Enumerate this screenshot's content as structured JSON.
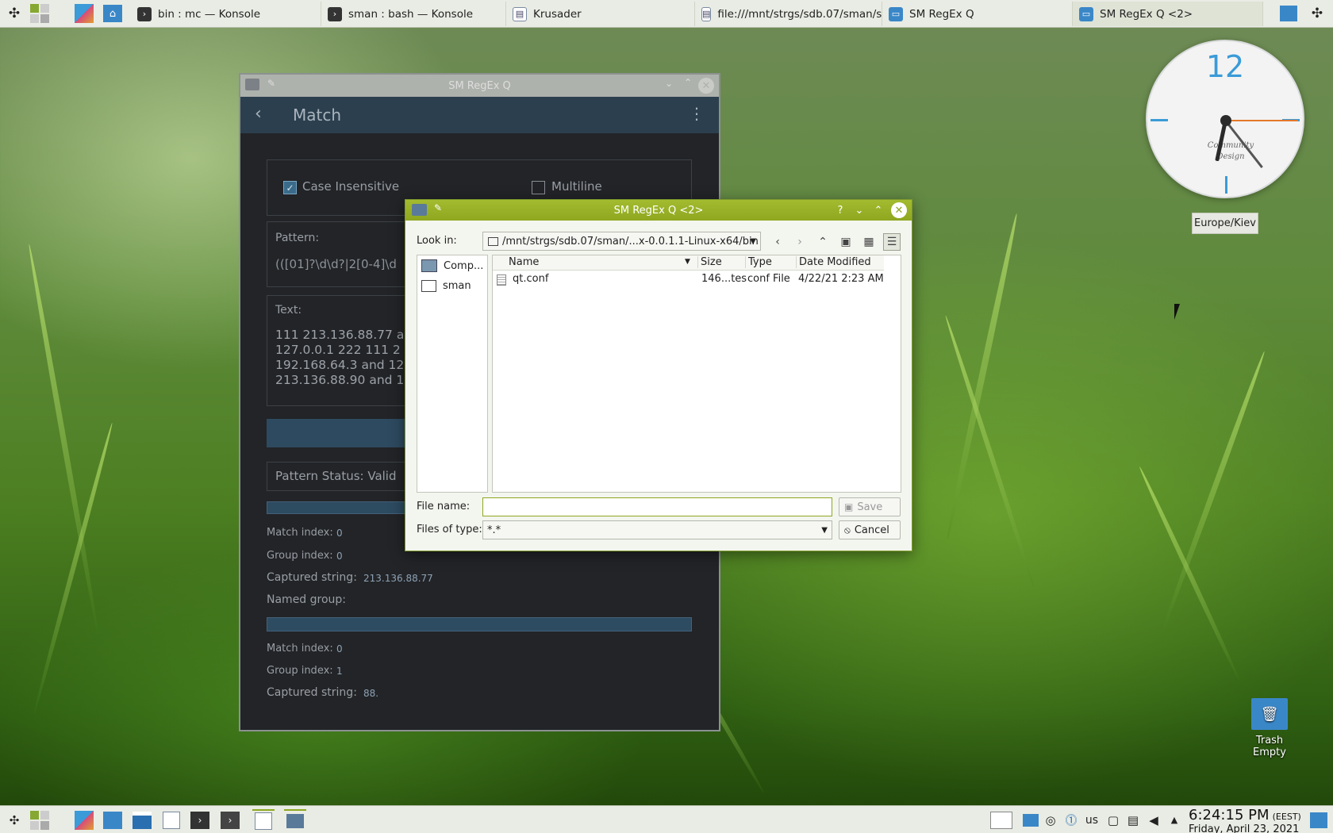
{
  "taskbar": {
    "tasks": [
      {
        "label": "bin : mc — Konsole",
        "icon": "terminal-icon"
      },
      {
        "label": "sman : bash — Konsole",
        "icon": "terminal-icon"
      },
      {
        "label": "Krusader",
        "icon": "krusader-icon"
      },
      {
        "label": "file:///mnt/strgs/sdb.07/sman/s...",
        "icon": "krusader-icon"
      },
      {
        "label": "SM RegEx Q",
        "icon": "folder-icon"
      },
      {
        "label": "SM RegEx Q <2>",
        "icon": "folder-icon"
      }
    ]
  },
  "main_window": {
    "title": "SM RegEx Q",
    "header_title": "Match",
    "case_insensitive_label": "Case Insensitive",
    "case_insensitive_checked": true,
    "multiline_label": "Multiline",
    "multiline_checked": false,
    "pattern_label": "Pattern:",
    "pattern_value": "(([01]?\\d\\d?|2[0-4]\\d",
    "text_label": "Text:",
    "text_lines": [
      "111 213.136.88.77 a",
      "127.0.0.1 222 111 2",
      "192.168.64.3 and 12",
      "213.136.88.90 and 1"
    ],
    "pattern_status": "Pattern Status: Valid",
    "match1": {
      "match_index_label": "Match index:",
      "match_index": "0",
      "group_index_label": "Group index:",
      "group_index": "0",
      "captured_label": "Captured string:",
      "captured": "213.136.88.77"
    },
    "named_group_label": "Named group:",
    "match2": {
      "match_index_label": "Match index:",
      "match_index": "0",
      "group_index_label": "Group index:",
      "group_index": "1",
      "captured_label": "Captured string:",
      "captured": "88."
    }
  },
  "dialog": {
    "title": "SM RegEx Q <2>",
    "look_in_label": "Look in:",
    "look_in_path": "/mnt/strgs/sdb.07/sman/...x-0.0.1.1-Linux-x64/bin",
    "places": [
      {
        "label": "Comp...",
        "icon": "computer-icon"
      },
      {
        "label": "sman",
        "icon": "folder-icon"
      }
    ],
    "columns": {
      "name": "Name",
      "size": "Size",
      "type": "Type",
      "date": "Date Modified"
    },
    "files": [
      {
        "name": "qt.conf",
        "size": "146...tes",
        "type": "conf File",
        "date": "4/22/21 2:23 AM"
      }
    ],
    "file_name_label": "File name:",
    "file_name_value": "",
    "files_of_type_label": "Files of type:",
    "files_of_type_value": "*.*",
    "save_label": "Save",
    "cancel_label": "Cancel"
  },
  "clock_widget": {
    "numeral": "12",
    "brand": "Community Design",
    "timezone": "Europe/Kiev"
  },
  "desktop": {
    "trash_label": "Trash",
    "trash_status": "Empty"
  },
  "tray": {
    "keyboard_layout": "us",
    "time": "6:24:15 PM",
    "tz": "(EEST)",
    "date": "Friday, April 23, 2021"
  }
}
